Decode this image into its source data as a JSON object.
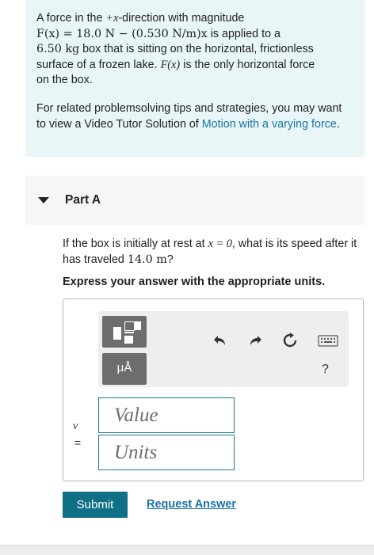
{
  "problem": {
    "line1_a": "A force in the ",
    "line1_math": "+x",
    "line1_b": "-direction with magnitude",
    "line2_math": "F(x) = 18.0 N − (0.530 N/m)x",
    "line2_b": " is applied to a",
    "line3_math": "6.50 kg",
    "line3_b": " box that is sitting on the horizontal, frictionless",
    "line4_a": "surface of a frozen lake. ",
    "line4_math": "F(x)",
    "line4_b": " is the only horizontal force",
    "line5": "on the box.",
    "tips_a": "For related problemsolving tips and strategies, you may want to view a Video Tutor Solution of ",
    "tips_link": "Motion with a varying force",
    "tips_b": "."
  },
  "part": {
    "title": "Part A",
    "question_a": "If the box is initially at rest at ",
    "question_math1": "x = 0",
    "question_b": ", what is its speed after it has traveled ",
    "question_math2": "14.0 m",
    "question_c": "?",
    "instruction": "Express your answer with the appropriate units."
  },
  "toolbar": {
    "mu_label": "μÅ",
    "help": "?",
    "icons": [
      "template-icon",
      "units-icon",
      "undo-icon",
      "redo-icon",
      "reset-icon",
      "keyboard-icon",
      "help-icon"
    ]
  },
  "answer": {
    "variable": "v",
    "equals": "=",
    "value_placeholder": "Value",
    "units_placeholder": "Units"
  },
  "actions": {
    "submit": "Submit",
    "request": "Request Answer"
  },
  "colors": {
    "intro_bg": "#e9f6f7",
    "link": "#1a73a8",
    "submit_bg": "#0f6f86",
    "field_border": "#1a7f8c"
  }
}
